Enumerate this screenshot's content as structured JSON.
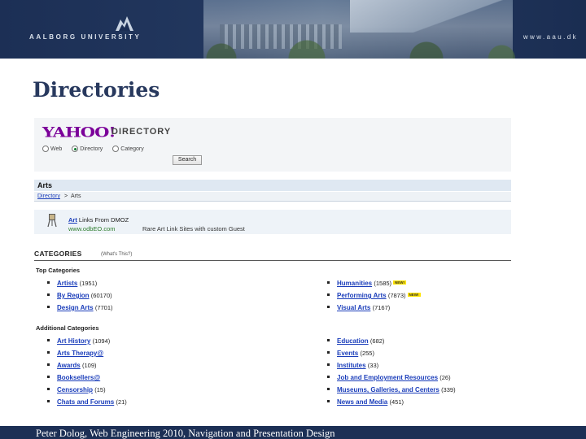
{
  "banner": {
    "university": "AALBORG UNIVERSITY",
    "url": "www.aau.dk"
  },
  "slide": {
    "title": "Directories"
  },
  "screenshot": {
    "logo": "YAHOO!",
    "directory_label": "DIRECTORY",
    "search_options": [
      {
        "label": "Web",
        "selected": false
      },
      {
        "label": "Directory",
        "selected": true
      },
      {
        "label": "Category",
        "selected": false
      }
    ],
    "search_button": "Search",
    "section_title": "Arts",
    "breadcrumb": {
      "root": "Directory",
      "separator": ">",
      "current": "Arts"
    },
    "sponsor": {
      "title_link": "Art",
      "title_rest": " Links From DMOZ",
      "url": "www.odbEO.com",
      "description": "Rare Art Link Sites with custom Guest"
    },
    "categories_header": "CATEGORIES",
    "categories_note": "(What's This?)",
    "top_label": "Top Categories",
    "top_left": [
      {
        "name": "Artists",
        "count": "(1951)",
        "new": false
      },
      {
        "name": "By Region",
        "count": "(60170)",
        "new": false
      },
      {
        "name": "Design Arts",
        "count": "(7701)",
        "new": false
      }
    ],
    "top_right": [
      {
        "name": "Humanities",
        "count": "(1585)",
        "new": true
      },
      {
        "name": "Performing Arts",
        "count": "(7873)",
        "new": true
      },
      {
        "name": "Visual Arts",
        "count": "(7167)",
        "new": false
      }
    ],
    "additional_label": "Additional Categories",
    "add_left": [
      {
        "name": "Art History",
        "count": "(1094)"
      },
      {
        "name": "Arts Therapy@",
        "count": ""
      },
      {
        "name": "Awards",
        "count": "(109)"
      },
      {
        "name": "Booksellers@",
        "count": ""
      },
      {
        "name": "Censorship",
        "count": "(15)"
      },
      {
        "name": "Chats and Forums",
        "count": "(21)"
      }
    ],
    "add_right": [
      {
        "name": "Education",
        "count": "(682)"
      },
      {
        "name": "Events",
        "count": "(255)"
      },
      {
        "name": "Institutes",
        "count": "(33)"
      },
      {
        "name": "Job and Employment Resources",
        "count": "(26)"
      },
      {
        "name": "Museums, Galleries, and Centers",
        "count": "(339)"
      },
      {
        "name": "News and Media",
        "count": "(451)"
      }
    ],
    "new_badge": "NEW!"
  },
  "footer": {
    "text": "Peter Dolog, Web Engineering 2010, Navigation and Presentation Design"
  }
}
